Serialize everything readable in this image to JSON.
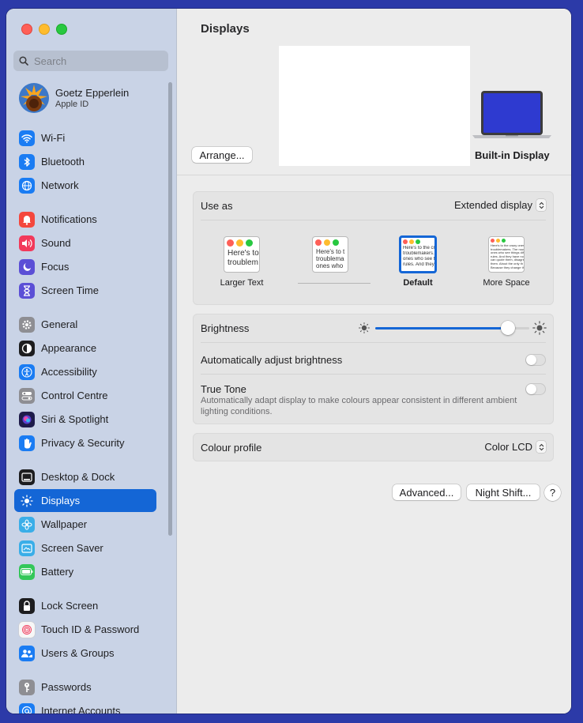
{
  "search": {
    "placeholder": "Search"
  },
  "profile": {
    "name": "Goetz Epperlein",
    "subtitle": "Apple ID"
  },
  "sidebar": {
    "items": [
      {
        "label": "Wi-Fi",
        "icon": "wifi-icon",
        "color": "#1a7cf3"
      },
      {
        "label": "Bluetooth",
        "icon": "bluetooth-icon",
        "color": "#1a7cf3"
      },
      {
        "label": "Network",
        "icon": "globe-icon",
        "color": "#1a7cf3"
      },
      {
        "label": "Notifications",
        "icon": "bell-icon",
        "color": "#f4473d"
      },
      {
        "label": "Sound",
        "icon": "speaker-icon",
        "color": "#f2395a"
      },
      {
        "label": "Focus",
        "icon": "moon-icon",
        "color": "#5b4fd6"
      },
      {
        "label": "Screen Time",
        "icon": "hourglass-icon",
        "color": "#5b4fd6"
      },
      {
        "label": "General",
        "icon": "gear-icon",
        "color": "#8e8e93"
      },
      {
        "label": "Appearance",
        "icon": "appearance-icon",
        "color": "#1d1d1f"
      },
      {
        "label": "Accessibility",
        "icon": "accessibility-icon",
        "color": "#1a7cf3"
      },
      {
        "label": "Control Centre",
        "icon": "switches-icon",
        "color": "#8e8e93"
      },
      {
        "label": "Siri & Spotlight",
        "icon": "siri-icon",
        "color": "#3a3a8c"
      },
      {
        "label": "Privacy & Security",
        "icon": "hand-icon",
        "color": "#1a7cf3"
      },
      {
        "label": "Desktop & Dock",
        "icon": "dock-icon",
        "color": "#1d1d1f"
      },
      {
        "label": "Displays",
        "icon": "brightness-icon",
        "color": "#1a7cf3"
      },
      {
        "label": "Wallpaper",
        "icon": "flower-icon",
        "color": "#3aaee8"
      },
      {
        "label": "Screen Saver",
        "icon": "screensaver-icon",
        "color": "#3aaee8"
      },
      {
        "label": "Battery",
        "icon": "battery-icon",
        "color": "#34c759"
      },
      {
        "label": "Lock Screen",
        "icon": "lock-icon",
        "color": "#1d1d1f"
      },
      {
        "label": "Touch ID & Password",
        "icon": "fingerprint-icon",
        "color": "#f2f2f2"
      },
      {
        "label": "Users & Groups",
        "icon": "users-icon",
        "color": "#1a7cf3"
      },
      {
        "label": "Passwords",
        "icon": "key-icon",
        "color": "#8e8e93"
      },
      {
        "label": "Internet Accounts",
        "icon": "at-icon",
        "color": "#1a7cf3"
      }
    ],
    "selected": "Displays"
  },
  "main": {
    "title": "Displays",
    "arrange_label": "Arrange...",
    "builtin_label": "Built-in Display",
    "use_as_label": "Use as",
    "use_as_value": "Extended display",
    "resolutions": [
      {
        "label": "Larger Text",
        "preview": [
          "Here's to",
          "troublem"
        ]
      },
      {
        "label": "",
        "preview": [
          "Here's to t",
          "troublema",
          "ones who"
        ]
      },
      {
        "label": "Default",
        "preview": [
          "Here's to the cr",
          "troublemakers.",
          "ones who see th",
          "rules. And they"
        ]
      },
      {
        "label": "More Space",
        "preview": [
          "Here's to the crazy ones",
          "troublemakers. The roun",
          "ones who see things diff",
          "rules. And they have no",
          "can quote them, disagre",
          "them. About the only th",
          "Because they change th"
        ]
      }
    ],
    "brightness_label": "Brightness",
    "brightness_level": 0.86,
    "auto_brightness_label": "Automatically adjust brightness",
    "true_tone_label": "True Tone",
    "true_tone_desc": "Automatically adapt display to make colours appear consistent in different ambient lighting conditions.",
    "colour_profile_label": "Colour profile",
    "colour_profile_value": "Color LCD",
    "advanced_label": "Advanced...",
    "night_shift_label": "Night Shift...",
    "help_label": "?"
  }
}
